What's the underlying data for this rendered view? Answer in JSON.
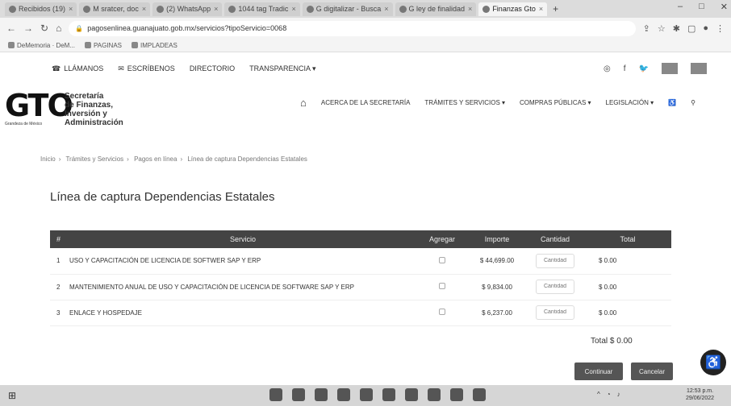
{
  "browser": {
    "tabs": [
      {
        "label": "Recibidos (19)"
      },
      {
        "label": "M sratcer, doc"
      },
      {
        "label": "(2) WhatsApp"
      },
      {
        "label": "1044 tag Tradic"
      },
      {
        "label": "G digitalizar - Busca"
      },
      {
        "label": "G ley de finalidad"
      },
      {
        "label": "Finanzas Gto",
        "active": true
      }
    ],
    "newtab": "+",
    "url": "pagosenlinea.guanajuato.gob.mx/servicios?tipoServicio=0068",
    "bookmarks": [
      "DeMemoria · DeM...",
      "PAGINAS",
      "IMPLADEAS"
    ]
  },
  "topnav": {
    "items": [
      "LLÁMANOS",
      "ESCRÍBENOS",
      "DIRECTORIO",
      "TRANSPARENCIA ▾"
    ]
  },
  "header": {
    "logo_text": "GTO",
    "logo_sub": "Grandeza de México",
    "secretaria_lines": [
      "Secretaría",
      "de Finanzas,",
      "Inversión y",
      "Administración"
    ],
    "menu": [
      "ACERCA DE LA SECRETARÍA",
      "TRÁMITES Y SERVICIOS ▾",
      "COMPRAS PÚBLICAS ▾",
      "LEGISLACIÓN ▾"
    ]
  },
  "breadcrumb": [
    "Inicio",
    "Trámites y Servicios",
    "Pagos en línea",
    "Línea de captura Dependencias Estatales"
  ],
  "page_title": "Línea de captura Dependencias Estatales",
  "table": {
    "headers": [
      "#",
      "Servicio",
      "Agregar",
      "Importe",
      "Cantidad",
      "Total"
    ],
    "rows": [
      {
        "num": "1",
        "service": "USO Y CAPACITACIÓN DE LICENCIA DE SOFTWER SAP Y ERP",
        "importe": "$ 44,699.00",
        "cantidad_placeholder": "Cantidad",
        "total": "$ 0.00"
      },
      {
        "num": "2",
        "service": "MANTENIMIENTO ANUAL DE USO Y CAPACITACIÓN DE LICENCIA DE SOFTWARE SAP Y ERP",
        "importe": "$ 9,834.00",
        "cantidad_placeholder": "Cantidad",
        "total": "$ 0.00"
      },
      {
        "num": "3",
        "service": "ENLACE Y HOSPEDAJE",
        "importe": "$ 6,237.00",
        "cantidad_placeholder": "Cantidad",
        "total": "$ 0.00"
      }
    ]
  },
  "total_label": "Total $ 0.00",
  "buttons": {
    "continuar": "Continuar",
    "cancelar": "Cancelar"
  },
  "taskbar": {
    "time": "12:53 p.m.",
    "date": "29/06/2022"
  }
}
